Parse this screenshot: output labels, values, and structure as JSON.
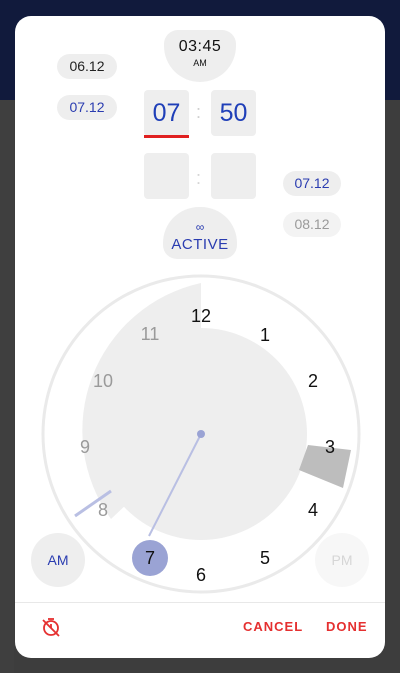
{
  "header": {
    "now_time": "03:45",
    "now_period": "AM"
  },
  "date_chips": [
    "06.12",
    "07.12",
    "07.12",
    "08.12"
  ],
  "time_entry": {
    "hour": "07",
    "minute": "50",
    "separator": ":"
  },
  "status": {
    "symbol": "∞",
    "label": "ACTIVE"
  },
  "clock": {
    "numbers": [
      "12",
      "1",
      "2",
      "3",
      "4",
      "5",
      "6",
      "7",
      "8",
      "9",
      "10",
      "11"
    ],
    "selected_hour": "7",
    "accent_color": "#9aa3d4",
    "hand_color": "#b9bfe3"
  },
  "period_buttons": {
    "am_label": "AM",
    "pm_label": "PM",
    "selected": "AM"
  },
  "actions": {
    "cancel_label": "CANCEL",
    "done_label": "DONE",
    "timer_icon": "timer-off-icon"
  },
  "colors": {
    "accent": "#2a3cb0",
    "action": "#e53030",
    "backdrop_top": "#111a3c"
  }
}
